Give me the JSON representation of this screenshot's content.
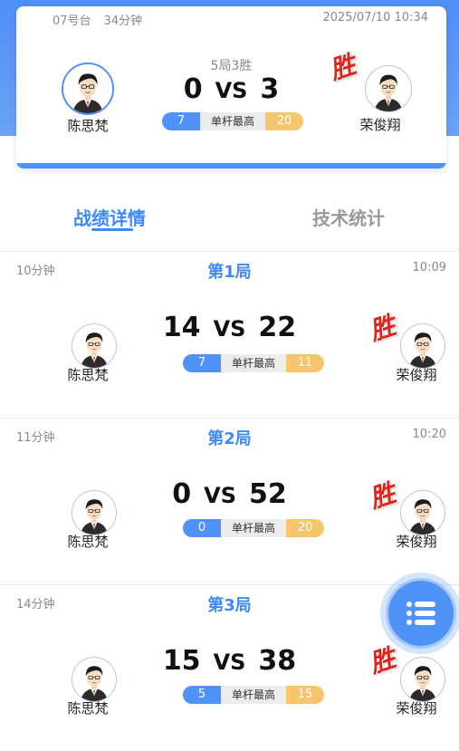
{
  "header": {
    "table": "07号台",
    "duration": "34分钟",
    "datetime": "2025/07/10 10:34",
    "format": "5局3胜",
    "player_left": "陈思梵",
    "player_right": "荣俊翔",
    "score_left": "0",
    "score_right": "3",
    "vs": "VS",
    "high_break_label": "单杆最高",
    "high_break_left": "7",
    "high_break_right": "20",
    "win_mark": "胜"
  },
  "tabs": {
    "record": "战绩详情",
    "stats": "技术统计"
  },
  "games": [
    {
      "duration": "10分钟",
      "title": "第1局",
      "time": "10:09",
      "player_left": "陈思梵",
      "player_right": "荣俊翔",
      "score_left": "14",
      "score_right": "22",
      "vs": "VS",
      "high_break_label": "单杆最高",
      "high_break_left": "7",
      "high_break_right": "11",
      "win_mark": "胜"
    },
    {
      "duration": "11分钟",
      "title": "第2局",
      "time": "10:20",
      "player_left": "陈思梵",
      "player_right": "荣俊翔",
      "score_left": "0",
      "score_right": "52",
      "vs": "VS",
      "high_break_label": "单杆最高",
      "high_break_left": "0",
      "high_break_right": "20",
      "win_mark": "胜"
    },
    {
      "duration": "14分钟",
      "title": "第3局",
      "time": "",
      "player_left": "陈思梵",
      "player_right": "荣俊翔",
      "score_left": "15",
      "score_right": "38",
      "vs": "VS",
      "high_break_label": "单杆最高",
      "high_break_left": "5",
      "high_break_right": "15",
      "win_mark": "胜"
    }
  ],
  "fab": {
    "icon": "list-icon"
  },
  "colors": {
    "primary": "#4f93f7",
    "accent_yellow": "#f6c66e",
    "win_red": "#e0241b"
  }
}
